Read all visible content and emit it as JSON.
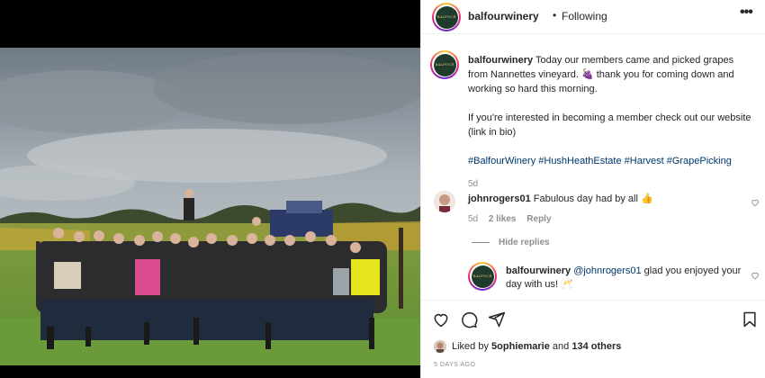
{
  "post": {
    "username": "balfourwinery",
    "separator": "•",
    "follow_status": "Following",
    "more_label": "•••",
    "avatar_logo_line1": "BALFOUR",
    "avatar_logo_line2": "WINERY"
  },
  "caption": {
    "username": "balfourwinery",
    "line1": "Today our members came and picked grapes from Nannettes vineyard.",
    "grape_glyph": "🍇",
    "line1b": "thank you for coming down and working so hard this morning.",
    "line2": "If you're interested in becoming a member check out our website (link in bio)",
    "hashtags": "#BalfourWinery #HushHeathEstate #Harvest #GrapePicking",
    "time": "5d"
  },
  "comments": [
    {
      "username": "johnrogers01",
      "text": "Fabulous day had by all",
      "emoji": "👍",
      "time": "5d",
      "likes": "2 likes",
      "reply_label": "Reply"
    }
  ],
  "replies_toggle": "Hide replies",
  "reply": {
    "username": "balfourwinery",
    "mention": "@johnrogers01",
    "text": "glad you enjoyed your day with us!",
    "emoji": "🥂"
  },
  "likes": {
    "prefix": "Liked by",
    "user": "5ophiemarie",
    "middle": "and",
    "count": "134 others"
  },
  "timestamp": "5 DAYS AGO",
  "icons": {
    "like": "heart-icon",
    "comment": "comment-icon",
    "share": "share-icon",
    "save": "bookmark-icon",
    "more": "more-icon"
  },
  "colors": {
    "link": "#00376b",
    "muted": "#8e8e8e",
    "text": "#262626"
  }
}
